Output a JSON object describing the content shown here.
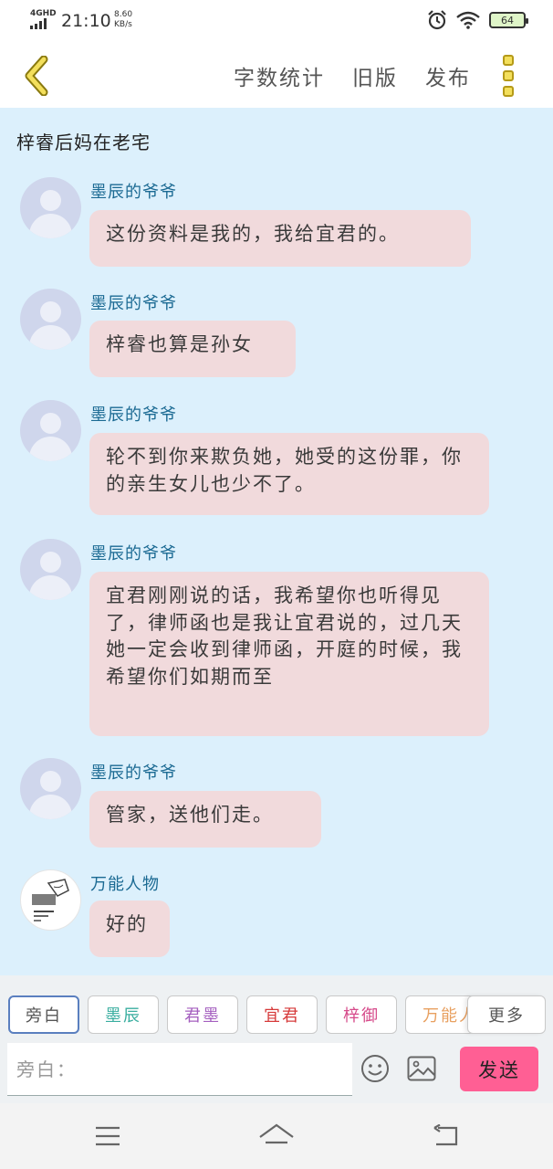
{
  "status_bar": {
    "network": "4GHD",
    "time": "21:10",
    "speed_value": "8.60",
    "speed_unit": "KB/s",
    "battery": "64"
  },
  "app_bar": {
    "actions": [
      "字数统计",
      "旧版",
      "发布"
    ]
  },
  "chat": {
    "title": "梓睿后妈在老宅",
    "messages": [
      {
        "sender": "墨辰的爷爷",
        "text": "这份资料是我的，我给宜君的。"
      },
      {
        "sender": "墨辰的爷爷",
        "text": "梓睿也算是孙女"
      },
      {
        "sender": "墨辰的爷爷",
        "text": "轮不到你来欺负她，她受的这份罪，你的亲生女儿也少不了。"
      },
      {
        "sender": "墨辰的爷爷",
        "text": "宜君刚刚说的话，我希望你也听得见了，律师函也是我让宜君说的，过几天她一定会收到律师函，开庭的时候，我希望你们如期而至"
      },
      {
        "sender": "墨辰的爷爷",
        "text": "管家，送他们走。"
      },
      {
        "sender": "万能人物",
        "text": "好的"
      }
    ]
  },
  "roles": {
    "tabs": [
      {
        "label": "旁白",
        "color": "#555555"
      },
      {
        "label": "墨辰",
        "color": "#3aaea0"
      },
      {
        "label": "君墨",
        "color": "#a45fbf"
      },
      {
        "label": "宜君",
        "color": "#d63a3a"
      },
      {
        "label": "梓御",
        "color": "#d64a8a"
      },
      {
        "label": "万能人",
        "color": "#e8a060"
      }
    ],
    "more_label": "更多"
  },
  "composer": {
    "placeholder": "旁白：",
    "send_label": "发送"
  },
  "colors": {
    "chat_bg": "#dcf0fc",
    "bubble": "#f1dadc",
    "sender": "#1b6a93",
    "send_button": "#ff5f94",
    "accent_yellow": "#f3df5c"
  }
}
